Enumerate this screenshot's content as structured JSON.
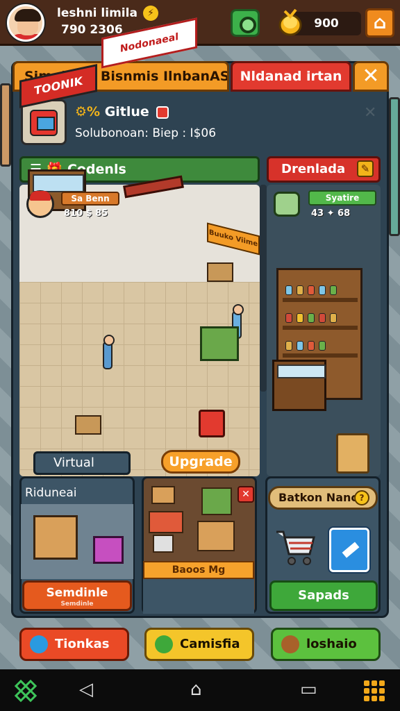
{
  "player": {
    "name": "leshni limila",
    "id": "790 2306"
  },
  "topbar": {
    "coins": "900"
  },
  "dialog": {
    "tab_left": "Simulkasi Bisnmis  IlnbanASla",
    "tab_right": "Nldanad irtan",
    "close_label": "✕"
  },
  "business": {
    "name": "Gitlue",
    "subtitle": "Solubonoan: Biep : I$06"
  },
  "sections": {
    "green_header": "Codenls",
    "red_header": "Drenlada"
  },
  "manager": {
    "name": "Sa Benn",
    "stats": "810  $ 85"
  },
  "staff": {
    "label": "Syatire",
    "stats": "43   ✦ 68"
  },
  "scene": {
    "sign_left": "TOONIK",
    "sign_right": "Nodonaeal",
    "sign_side": "Buuko Viime"
  },
  "labels": {
    "virtual": "Virtual",
    "upgrade": "Upgrade"
  },
  "cards": {
    "card1_title": "Riduneai",
    "card1_button": "Semdinle",
    "card1_button_sub": "Semdinle",
    "card2_label": "Baoos Mg",
    "card3_title": "Batkon Nanc",
    "card3_button": "Sapads"
  },
  "actions": {
    "red": "Tionkas",
    "yellow": "Camisfia",
    "green": "loshaio"
  },
  "colors": {
    "tab_orange": "#f39b26",
    "tab_red": "#e23a2f",
    "green": "#3e8a3c",
    "panel": "#2e4352"
  },
  "icons": {
    "nav_back": "◁",
    "nav_home": "⌂",
    "nav_recents": "▭"
  }
}
